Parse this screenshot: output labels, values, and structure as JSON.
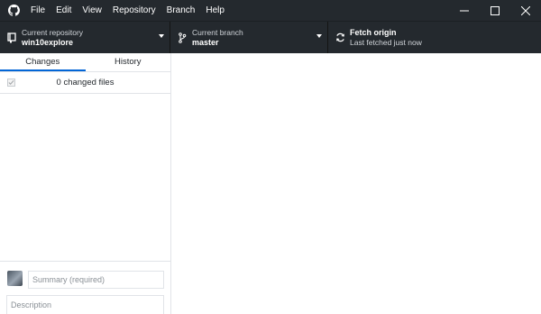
{
  "menu": {
    "items": [
      "File",
      "Edit",
      "View",
      "Repository",
      "Branch",
      "Help"
    ]
  },
  "window_controls": {
    "icons": [
      "minimize-icon",
      "maximize-icon",
      "close-icon"
    ]
  },
  "toolbar": {
    "repository": {
      "label": "Current repository",
      "value": "win10explore"
    },
    "branch": {
      "label": "Current branch",
      "value": "master"
    },
    "fetch": {
      "label": "Fetch origin",
      "status": "Last fetched just now"
    }
  },
  "sidebar": {
    "tabs": [
      {
        "label": "Changes",
        "selected": true
      },
      {
        "label": "History",
        "selected": false
      }
    ],
    "changes_summary": "0 changed files"
  },
  "commit": {
    "summary_placeholder": "Summary (required)",
    "description_placeholder": "Description"
  },
  "colors": {
    "toolbar_bg": "#24292e",
    "accent": "#0366d6",
    "border": "#e1e4e8"
  }
}
